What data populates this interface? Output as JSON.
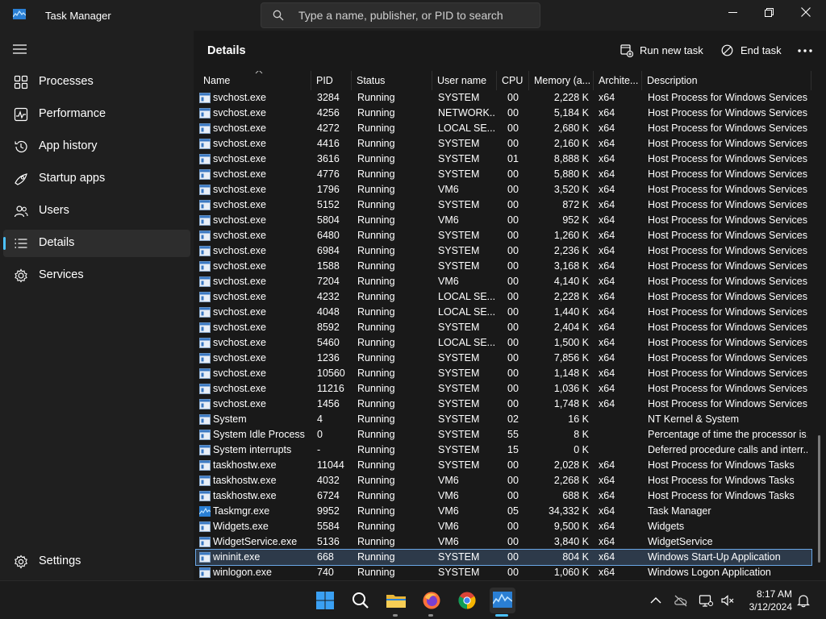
{
  "window": {
    "title": "Task Manager"
  },
  "search": {
    "placeholder": "Type a name, publisher, or PID to search"
  },
  "sidebar": {
    "items": [
      {
        "label": "Processes",
        "icon": "processes-icon",
        "active": false
      },
      {
        "label": "Performance",
        "icon": "performance-icon",
        "active": false
      },
      {
        "label": "App history",
        "icon": "app-history-icon",
        "active": false
      },
      {
        "label": "Startup apps",
        "icon": "startup-apps-icon",
        "active": false
      },
      {
        "label": "Users",
        "icon": "users-icon",
        "active": false
      },
      {
        "label": "Details",
        "icon": "details-icon",
        "active": true
      },
      {
        "label": "Services",
        "icon": "services-icon",
        "active": false
      }
    ],
    "settings_label": "Settings"
  },
  "main": {
    "title": "Details",
    "run_task_label": "Run new task",
    "end_task_label": "End task"
  },
  "table": {
    "columns": [
      "Name",
      "PID",
      "Status",
      "User name",
      "CPU",
      "Memory (a...",
      "Archite...",
      "Description"
    ],
    "rows": [
      [
        "svchost.exe",
        "3284",
        "Running",
        "SYSTEM",
        "00",
        "2,228 K",
        "x64",
        "Host Process for Windows Services"
      ],
      [
        "svchost.exe",
        "4256",
        "Running",
        "NETWORK...",
        "00",
        "5,184 K",
        "x64",
        "Host Process for Windows Services"
      ],
      [
        "svchost.exe",
        "4272",
        "Running",
        "LOCAL SE...",
        "00",
        "2,680 K",
        "x64",
        "Host Process for Windows Services"
      ],
      [
        "svchost.exe",
        "4416",
        "Running",
        "SYSTEM",
        "00",
        "2,160 K",
        "x64",
        "Host Process for Windows Services"
      ],
      [
        "svchost.exe",
        "3616",
        "Running",
        "SYSTEM",
        "01",
        "8,888 K",
        "x64",
        "Host Process for Windows Services"
      ],
      [
        "svchost.exe",
        "4776",
        "Running",
        "SYSTEM",
        "00",
        "5,880 K",
        "x64",
        "Host Process for Windows Services"
      ],
      [
        "svchost.exe",
        "1796",
        "Running",
        "VM6",
        "00",
        "3,520 K",
        "x64",
        "Host Process for Windows Services"
      ],
      [
        "svchost.exe",
        "5152",
        "Running",
        "SYSTEM",
        "00",
        "872 K",
        "x64",
        "Host Process for Windows Services"
      ],
      [
        "svchost.exe",
        "5804",
        "Running",
        "VM6",
        "00",
        "952 K",
        "x64",
        "Host Process for Windows Services"
      ],
      [
        "svchost.exe",
        "6480",
        "Running",
        "SYSTEM",
        "00",
        "1,260 K",
        "x64",
        "Host Process for Windows Services"
      ],
      [
        "svchost.exe",
        "6984",
        "Running",
        "SYSTEM",
        "00",
        "2,236 K",
        "x64",
        "Host Process for Windows Services"
      ],
      [
        "svchost.exe",
        "1588",
        "Running",
        "SYSTEM",
        "00",
        "3,168 K",
        "x64",
        "Host Process for Windows Services"
      ],
      [
        "svchost.exe",
        "7204",
        "Running",
        "VM6",
        "00",
        "4,140 K",
        "x64",
        "Host Process for Windows Services"
      ],
      [
        "svchost.exe",
        "4232",
        "Running",
        "LOCAL SE...",
        "00",
        "2,228 K",
        "x64",
        "Host Process for Windows Services"
      ],
      [
        "svchost.exe",
        "4048",
        "Running",
        "LOCAL SE...",
        "00",
        "1,440 K",
        "x64",
        "Host Process for Windows Services"
      ],
      [
        "svchost.exe",
        "8592",
        "Running",
        "SYSTEM",
        "00",
        "2,404 K",
        "x64",
        "Host Process for Windows Services"
      ],
      [
        "svchost.exe",
        "5460",
        "Running",
        "LOCAL SE...",
        "00",
        "1,500 K",
        "x64",
        "Host Process for Windows Services"
      ],
      [
        "svchost.exe",
        "1236",
        "Running",
        "SYSTEM",
        "00",
        "7,856 K",
        "x64",
        "Host Process for Windows Services"
      ],
      [
        "svchost.exe",
        "10560",
        "Running",
        "SYSTEM",
        "00",
        "1,148 K",
        "x64",
        "Host Process for Windows Services"
      ],
      [
        "svchost.exe",
        "11216",
        "Running",
        "SYSTEM",
        "00",
        "1,036 K",
        "x64",
        "Host Process for Windows Services"
      ],
      [
        "svchost.exe",
        "1456",
        "Running",
        "SYSTEM",
        "00",
        "1,748 K",
        "x64",
        "Host Process for Windows Services"
      ],
      [
        "System",
        "4",
        "Running",
        "SYSTEM",
        "02",
        "16 K",
        "",
        "NT Kernel & System"
      ],
      [
        "System Idle Process",
        "0",
        "Running",
        "SYSTEM",
        "55",
        "8 K",
        "",
        "Percentage of time the processor is..."
      ],
      [
        "System interrupts",
        "-",
        "Running",
        "SYSTEM",
        "15",
        "0 K",
        "",
        "Deferred procedure calls and interr..."
      ],
      [
        "taskhostw.exe",
        "11044",
        "Running",
        "SYSTEM",
        "00",
        "2,028 K",
        "x64",
        "Host Process for Windows Tasks"
      ],
      [
        "taskhostw.exe",
        "4032",
        "Running",
        "VM6",
        "00",
        "2,268 K",
        "x64",
        "Host Process for Windows Tasks"
      ],
      [
        "taskhostw.exe",
        "6724",
        "Running",
        "VM6",
        "00",
        "688 K",
        "x64",
        "Host Process for Windows Tasks"
      ],
      [
        "Taskmgr.exe",
        "9952",
        "Running",
        "VM6",
        "05",
        "34,332 K",
        "x64",
        "Task Manager"
      ],
      [
        "Widgets.exe",
        "5584",
        "Running",
        "VM6",
        "00",
        "9,500 K",
        "x64",
        "Widgets"
      ],
      [
        "WidgetService.exe",
        "5136",
        "Running",
        "VM6",
        "00",
        "3,840 K",
        "x64",
        "WidgetService"
      ],
      [
        "wininit.exe",
        "668",
        "Running",
        "SYSTEM",
        "00",
        "804 K",
        "x64",
        "Windows Start-Up Application"
      ],
      [
        "winlogon.exe",
        "740",
        "Running",
        "SYSTEM",
        "00",
        "1,060 K",
        "x64",
        "Windows Logon Application"
      ]
    ],
    "selected_row": 30,
    "taskmgr_row": 27
  },
  "taskbar": {
    "time": "8:17 AM",
    "date": "3/12/2024"
  },
  "colors": {
    "accent": "#4cc2ff",
    "selection": "#2d3a4a"
  }
}
